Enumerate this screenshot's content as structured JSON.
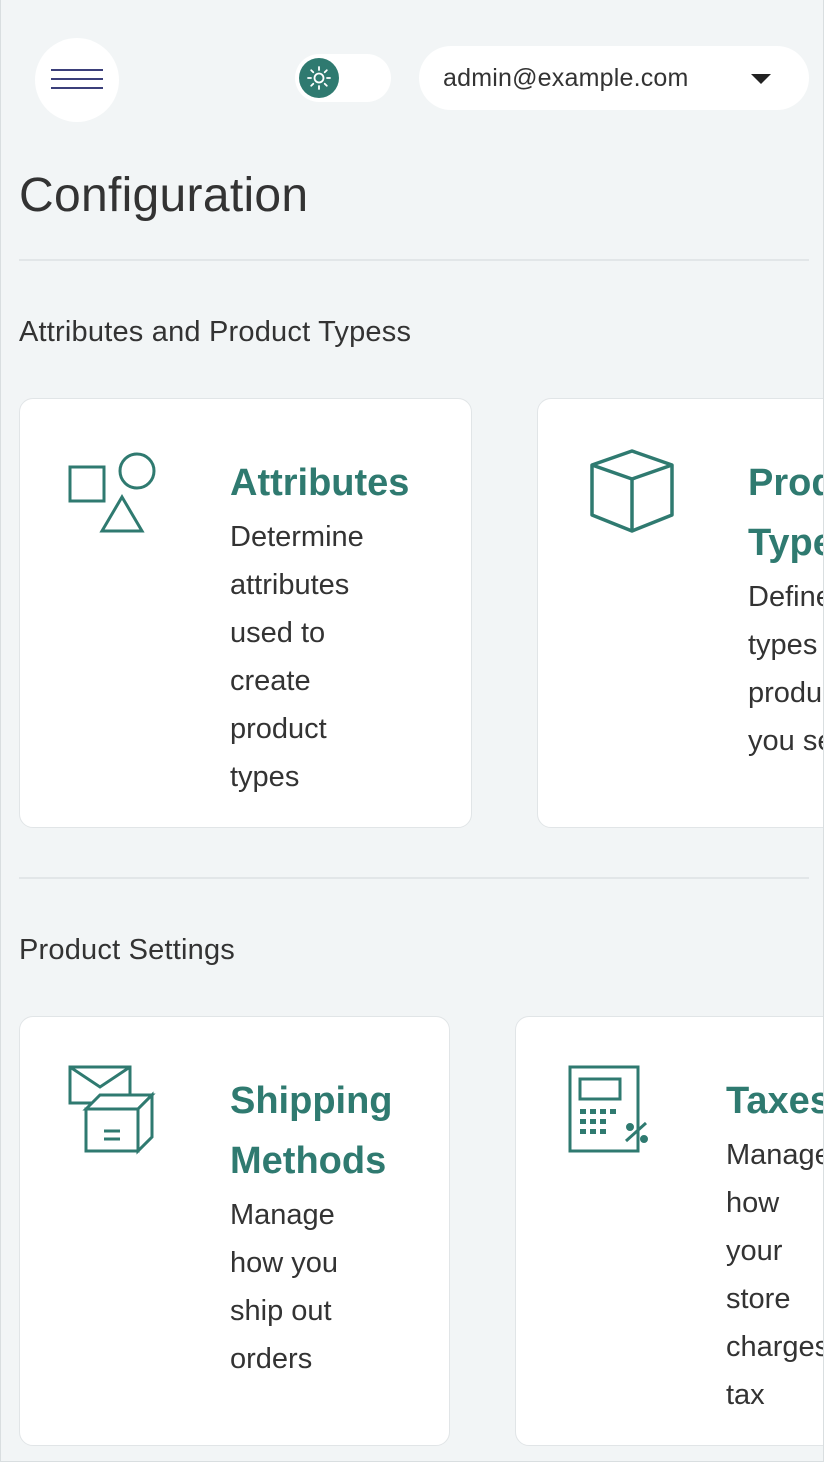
{
  "header": {
    "menu_icon": "hamburger-icon",
    "theme_icon": "sun-icon",
    "user_email": "admin@example.com",
    "caret_icon": "caret-down-icon"
  },
  "page": {
    "title": "Configuration"
  },
  "sections": [
    {
      "title": "Attributes and Product Typess",
      "cards": [
        {
          "icon": "shapes-icon",
          "title": "Attributes",
          "description": "Determine\nattributes\nused to\ncreate\nproduct\ntypes"
        },
        {
          "icon": "cube-icon",
          "title": "Product\nTypes",
          "description": "Define\ntypes of\nproducts\nyou sell"
        }
      ]
    },
    {
      "title": "Product Settings",
      "cards": [
        {
          "icon": "shipping-box-icon",
          "title": "Shipping\nMethods",
          "description": "Manage\nhow you\nship out\norders"
        },
        {
          "icon": "tax-calculator-icon",
          "title": "Taxes",
          "description": "Manage\nhow\nyour\nstore\ncharges\ntax"
        }
      ]
    }
  ],
  "colors": {
    "accent": "#2f7a70",
    "background": "#f2f5f6",
    "card": "#ffffff",
    "menu_lines": "#3b3f7a"
  }
}
